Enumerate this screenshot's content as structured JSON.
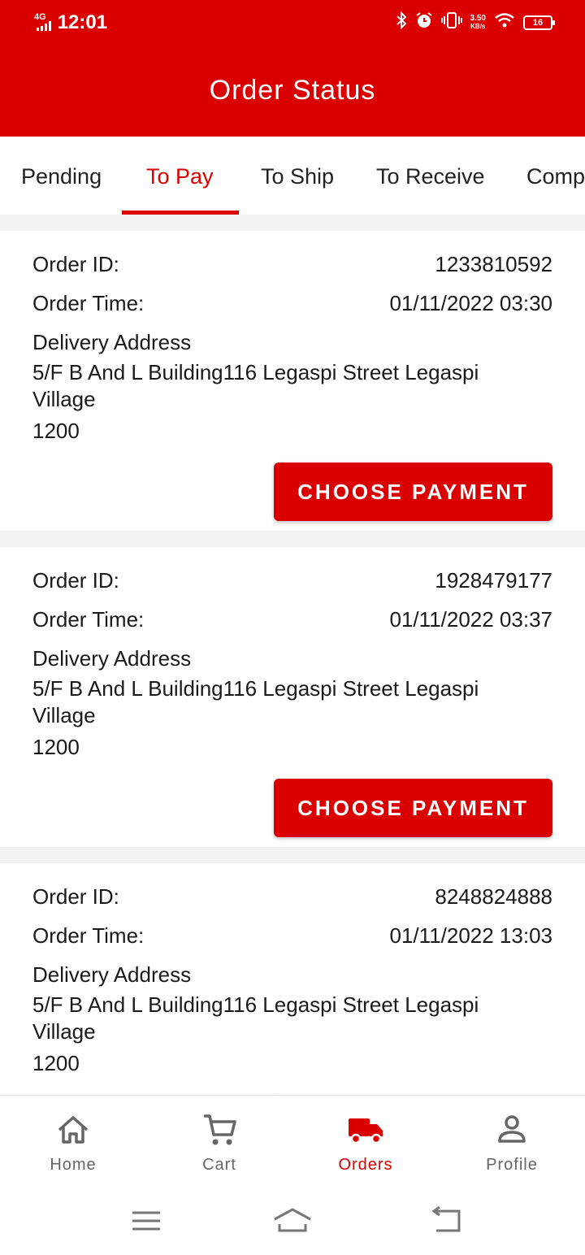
{
  "status_bar": {
    "network": "4G",
    "time": "12:01",
    "speed_value": "3.50",
    "speed_unit": "KB/s",
    "battery": "16"
  },
  "header": {
    "title": "Order Status"
  },
  "tabs": [
    {
      "label": "Pending",
      "active": false
    },
    {
      "label": "To Pay",
      "active": true
    },
    {
      "label": "To Ship",
      "active": false
    },
    {
      "label": "To Receive",
      "active": false
    },
    {
      "label": "Comp",
      "active": false
    }
  ],
  "labels": {
    "order_id": "Order ID:",
    "order_time": "Order Time:",
    "delivery_address": "Delivery Address",
    "choose_payment": "CHOOSE PAYMENT"
  },
  "orders": [
    {
      "id": "1233810592",
      "time": "01/11/2022 03:30",
      "address": "5/F B And L Building116 Legaspi Street Legaspi Village",
      "zip": "1200"
    },
    {
      "id": "1928479177",
      "time": "01/11/2022 03:37",
      "address": "5/F B And L Building116 Legaspi Street Legaspi Village",
      "zip": "1200"
    },
    {
      "id": "8248824888",
      "time": "01/11/2022 13:03",
      "address": "5/F B And L Building116 Legaspi Street Legaspi Village",
      "zip": "1200"
    }
  ],
  "bottom_nav": [
    {
      "label": "Home",
      "icon": "home-icon",
      "active": false
    },
    {
      "label": "Cart",
      "icon": "cart-icon",
      "active": false
    },
    {
      "label": "Orders",
      "icon": "truck-icon",
      "active": true
    },
    {
      "label": "Profile",
      "icon": "person-icon",
      "active": false
    }
  ],
  "colors": {
    "brand": "#db0000",
    "inactive": "#666666",
    "divider": "#f2f2f2"
  }
}
